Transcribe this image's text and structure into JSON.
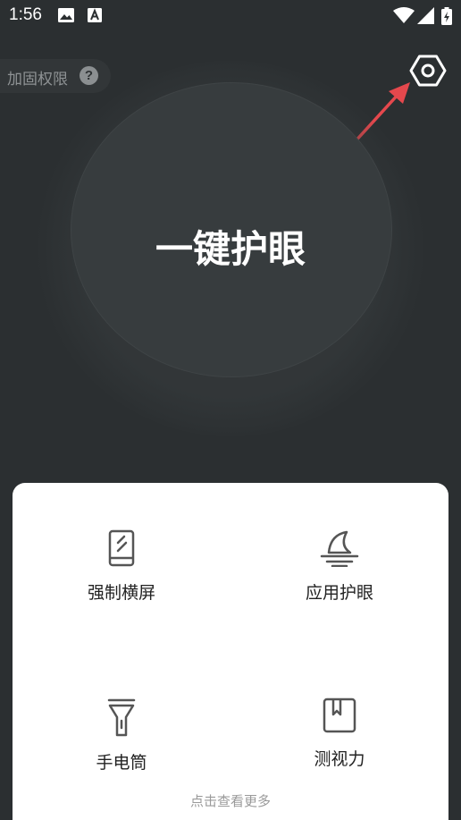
{
  "status_bar": {
    "time": "1:56"
  },
  "header": {
    "permission_label": "加固权限",
    "help_glyph": "?",
    "settings_icon": "hexagon-gear-icon"
  },
  "main": {
    "button_label": "一键护眼"
  },
  "tools": {
    "items": [
      {
        "label": "强制横屏",
        "icon": "phone-rotate-icon"
      },
      {
        "label": "应用护眼",
        "icon": "moon-horizon-icon"
      },
      {
        "label": "手电筒",
        "icon": "flashlight-icon"
      },
      {
        "label": "测视力",
        "icon": "bookmark-book-icon"
      }
    ],
    "more_label": "点击查看更多"
  },
  "colors": {
    "background": "#2b2f31",
    "circle": "#373c3e",
    "panel": "#ffffff",
    "arrow": "#e5484d"
  }
}
